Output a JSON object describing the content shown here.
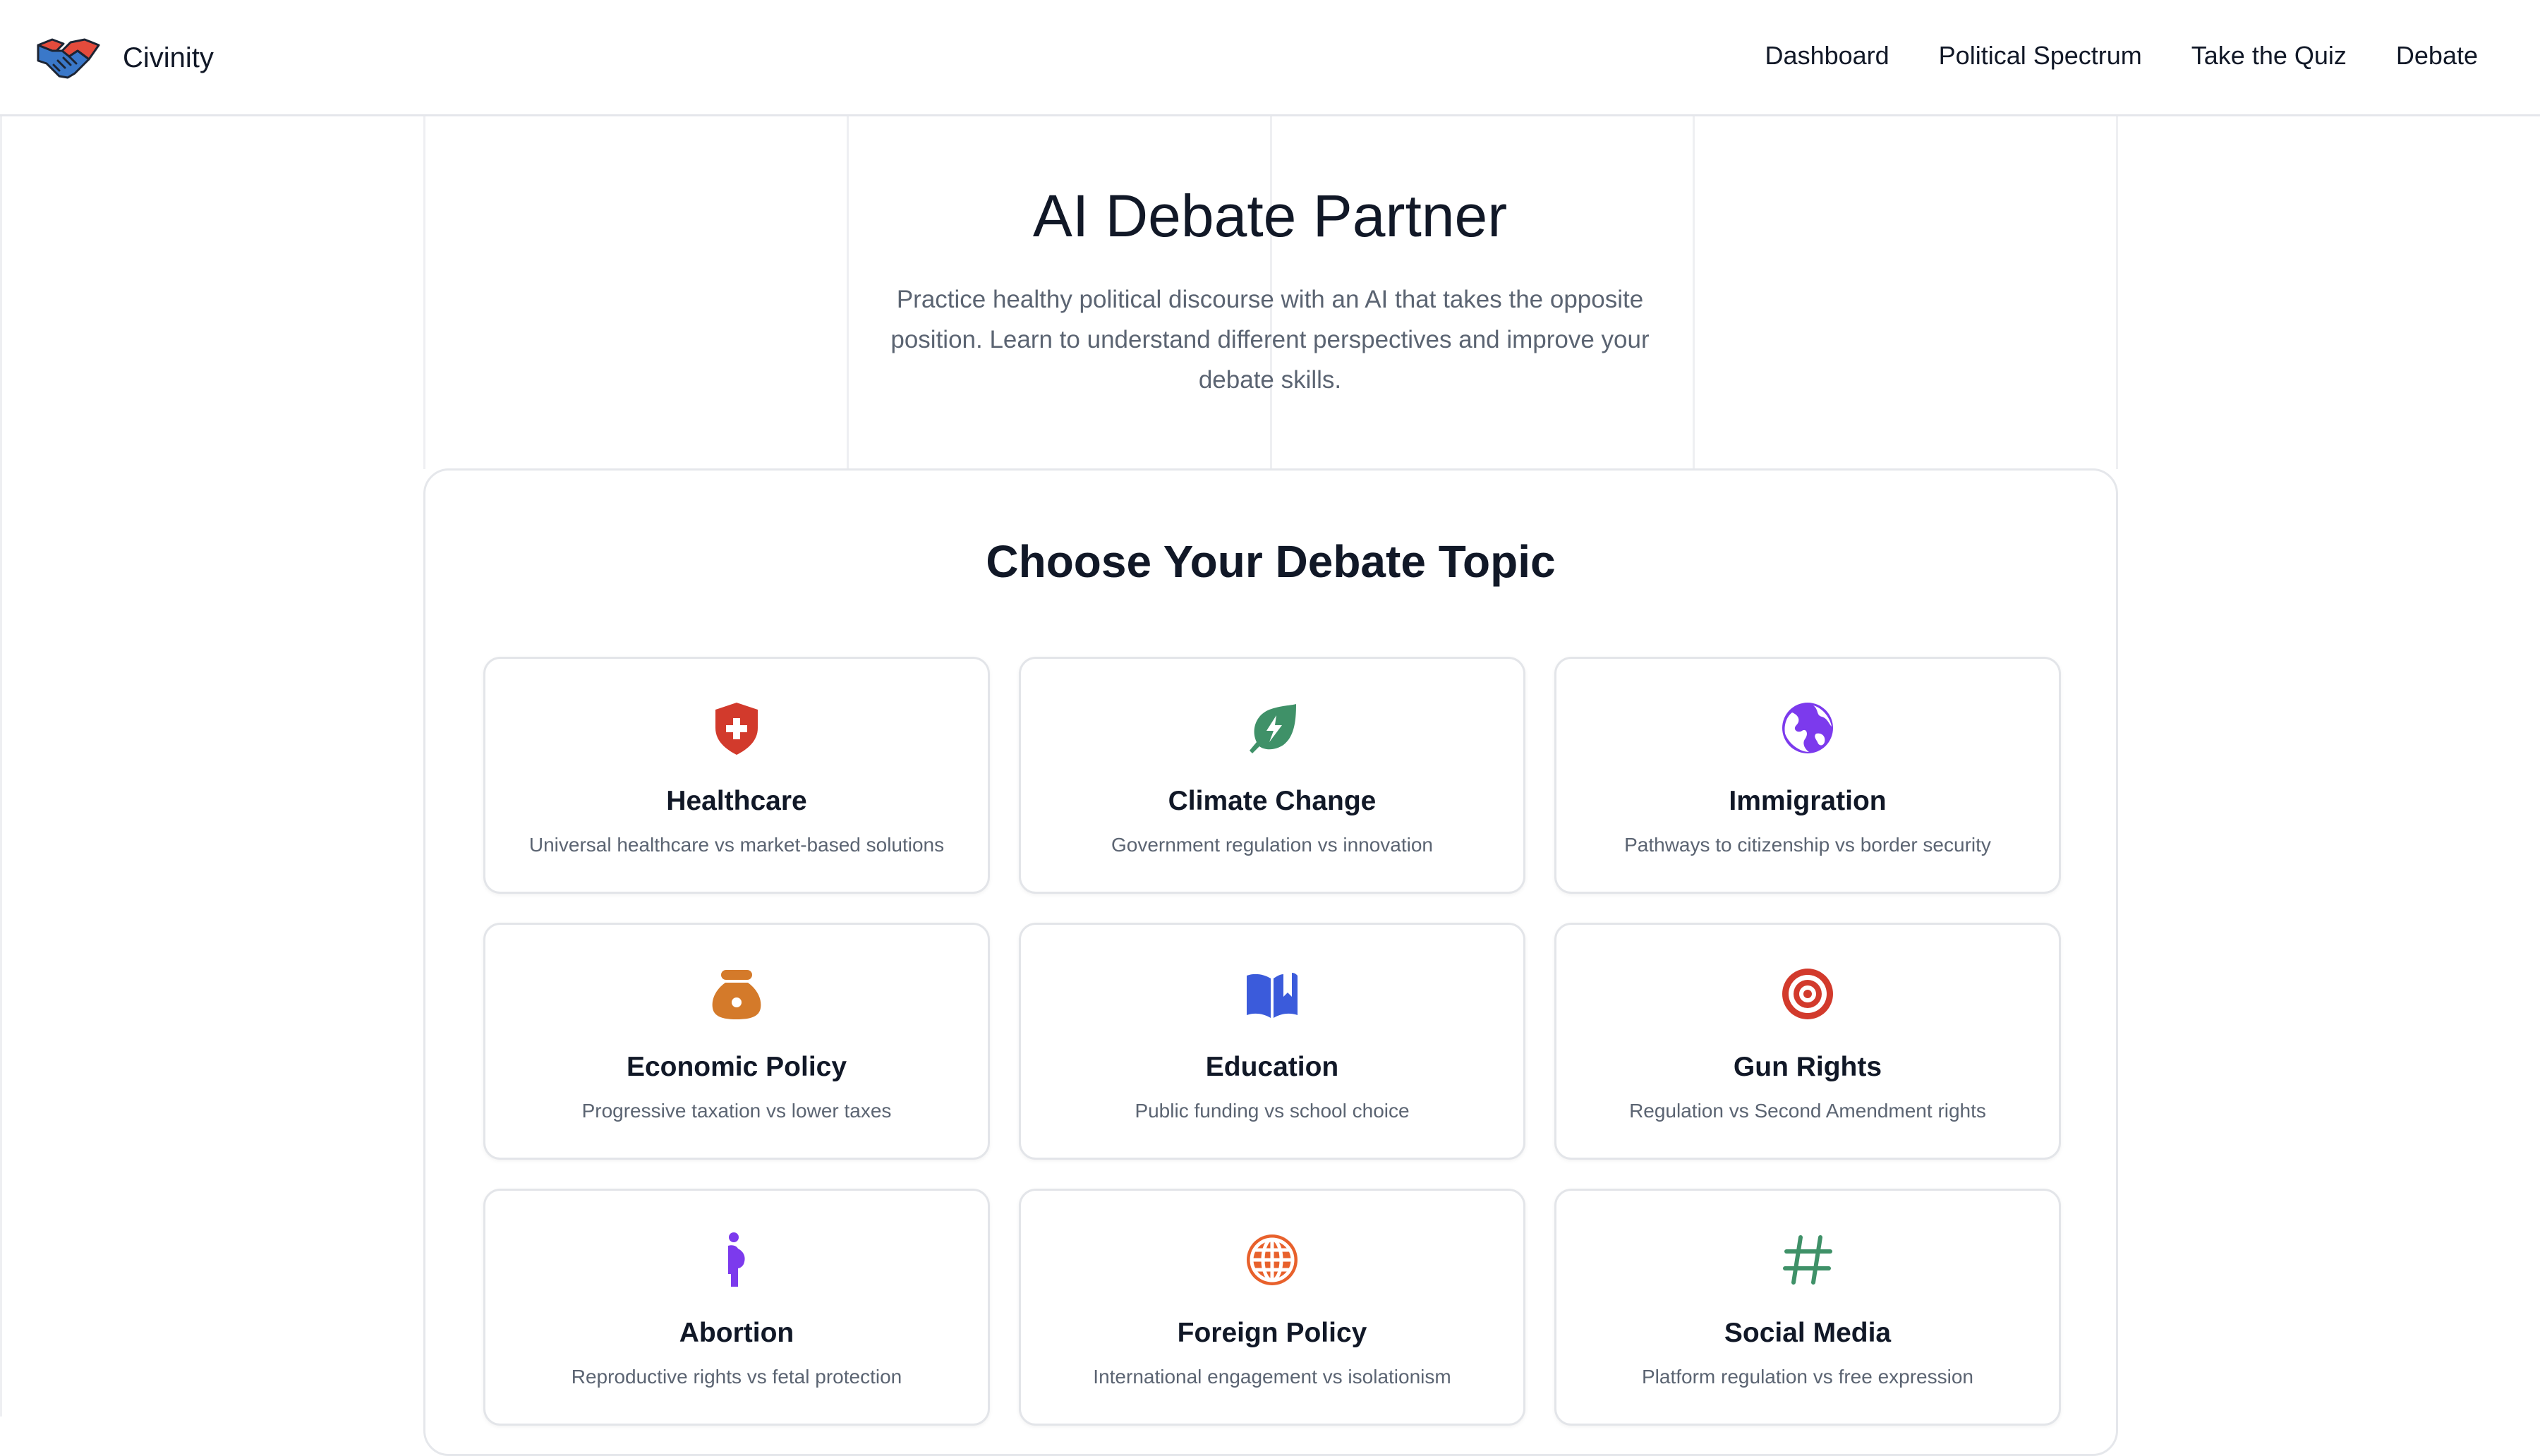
{
  "brand": {
    "name": "Civinity",
    "logo_icon": "handshake-icon"
  },
  "nav": {
    "items": [
      {
        "label": "Dashboard"
      },
      {
        "label": "Political Spectrum"
      },
      {
        "label": "Take the Quiz"
      },
      {
        "label": "Debate"
      }
    ]
  },
  "hero": {
    "title": "AI Debate Partner",
    "description": "Practice healthy political discourse with an AI that takes the opposite position. Learn to understand different perspectives and improve your debate skills."
  },
  "topics_panel": {
    "title": "Choose Your Debate Topic",
    "topics": [
      {
        "title": "Healthcare",
        "description": "Universal healthcare vs market-based solutions",
        "icon": "shield-plus-icon",
        "color": "#d23a2c"
      },
      {
        "title": "Climate Change",
        "description": "Government regulation vs innovation",
        "icon": "leaf-bolt-icon",
        "color": "#3f9168"
      },
      {
        "title": "Immigration",
        "description": "Pathways to citizenship vs border security",
        "icon": "globe-icon",
        "color": "#7c3aed"
      },
      {
        "title": "Economic Policy",
        "description": "Progressive taxation vs lower taxes",
        "icon": "money-bag-icon",
        "color": "#d47a2a"
      },
      {
        "title": "Education",
        "description": "Public funding vs school choice",
        "icon": "open-book-icon",
        "color": "#3b5bdb"
      },
      {
        "title": "Gun Rights",
        "description": "Regulation vs Second Amendment rights",
        "icon": "target-icon",
        "color": "#d23a2c"
      },
      {
        "title": "Abortion",
        "description": "Reproductive rights vs fetal protection",
        "icon": "pregnant-person-icon",
        "color": "#7c3aed"
      },
      {
        "title": "Foreign Policy",
        "description": "International engagement vs isolationism",
        "icon": "world-grid-icon",
        "color": "#e8612c"
      },
      {
        "title": "Social Media",
        "description": "Platform regulation vs free expression",
        "icon": "hashtag-icon",
        "color": "#3f9168"
      }
    ]
  }
}
